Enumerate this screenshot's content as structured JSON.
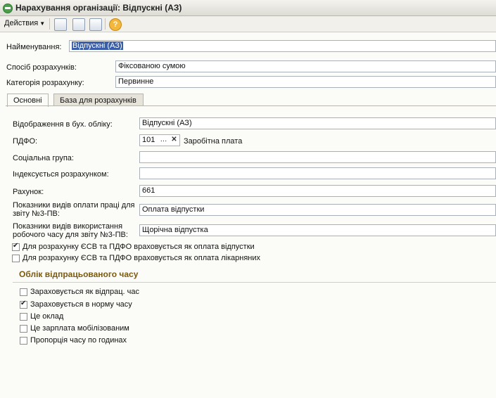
{
  "window": {
    "title": "Нарахування організації: Відпускні (АЗ)"
  },
  "toolbar": {
    "actions_label": "Действия",
    "help_label": "?"
  },
  "form": {
    "name_label": "Найменування:",
    "name_value": "Відпускні (АЗ)",
    "calc_method_label": "Спосіб розрахунків:",
    "calc_method_value": "Фіксованою сумою",
    "category_label": "Категорія розрахунку:",
    "category_value": "Первинне"
  },
  "tabs": [
    {
      "label": "Основні"
    },
    {
      "label": "База для розрахунків"
    }
  ],
  "main": {
    "accounting_label": "Відображення в бух. обліку:",
    "accounting_value": "Відпускні (АЗ)",
    "pdfo_label": "ПДФО:",
    "pdfo_code": "101",
    "pdfo_desc": "Заробітна плата",
    "social_group_label": "Соціальна група:",
    "social_group_value": "",
    "indexed_label": "Індексується розрахунком:",
    "indexed_value": "",
    "account_label": "Рахунок:",
    "account_value": "661",
    "pay_indicators_label_1": "Показники видів оплати праці для",
    "pay_indicators_label_2": "звіту №3-ПВ:",
    "pay_indicators_value": "Оплата відпустки",
    "time_indicators_label_1": "Показники видів використання",
    "time_indicators_label_2": "робочого часу для звіту №3-ПВ:",
    "time_indicators_value": "Щорічна відпустка",
    "cb_vacation": "Для розрахунку ЄСВ та ПДФО враховується як оплата відпустки",
    "cb_sick": "Для розрахунку ЄСВ та ПДФО враховується як оплата лікарняних"
  },
  "worktime": {
    "title": "Облік відпрацьованого часу",
    "items": [
      {
        "label": "Зараховується як відпрац. час",
        "checked": false
      },
      {
        "label": "Зараховується в норму часу",
        "checked": true
      },
      {
        "label": "Це оклад",
        "checked": false
      },
      {
        "label": "Це зарплата мобілізованим",
        "checked": false
      },
      {
        "label": "Пропорція часу по годинах",
        "checked": false
      }
    ]
  }
}
